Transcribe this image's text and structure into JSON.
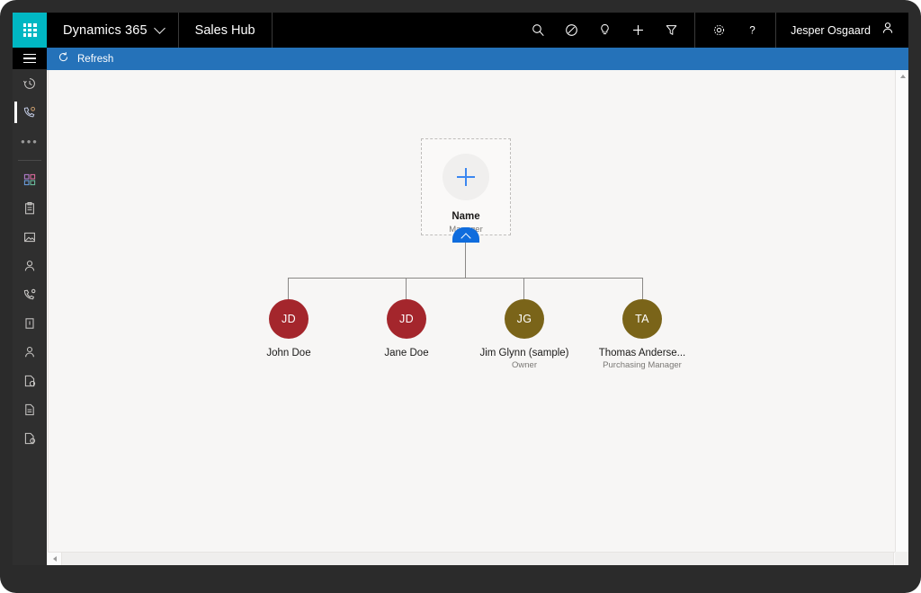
{
  "topbar": {
    "waffle_icon": "waffle-grid-icon",
    "brand": "Dynamics 365",
    "brand_chevron_icon": "chevron-down-icon",
    "app_area": "Sales Hub",
    "actions": [
      {
        "name": "search-icon",
        "label": "Search"
      },
      {
        "name": "assistant-icon",
        "label": "Assistant"
      },
      {
        "name": "lightbulb-icon",
        "label": "Insights"
      },
      {
        "name": "plus-icon",
        "label": "Quick create"
      },
      {
        "name": "filter-icon",
        "label": "Filter"
      }
    ],
    "settings_actions": [
      {
        "name": "gear-icon",
        "label": "Settings"
      },
      {
        "name": "help-icon",
        "label": "Help"
      }
    ],
    "user_name": "Jesper Osgaard",
    "user_avatar_icon": "person-icon"
  },
  "leftrail": {
    "hamburger_icon": "hamburger-icon",
    "items": [
      {
        "name": "sidebar-item-recent",
        "icon": "clock-history-icon",
        "active": false
      },
      {
        "name": "sidebar-item-pinned",
        "icon": "phone-contact-icon",
        "active": true
      },
      {
        "name": "sidebar-item-more",
        "icon": "ellipsis-icon",
        "active": false
      }
    ],
    "entities": [
      {
        "name": "sidebar-item-dashboards",
        "icon": "dashboard-icon"
      },
      {
        "name": "sidebar-item-activities",
        "icon": "clipboard-icon"
      },
      {
        "name": "sidebar-item-accounts",
        "icon": "briefcase-icon"
      },
      {
        "name": "sidebar-item-contacts",
        "icon": "person-icon"
      },
      {
        "name": "sidebar-item-leads",
        "icon": "phone-lead-icon"
      },
      {
        "name": "sidebar-item-opportunities",
        "icon": "opportunity-icon"
      },
      {
        "name": "sidebar-item-competitors",
        "icon": "person-outline-icon"
      },
      {
        "name": "sidebar-item-quotes",
        "icon": "document-check-icon"
      },
      {
        "name": "sidebar-item-orders",
        "icon": "document-icon"
      },
      {
        "name": "sidebar-item-invoices",
        "icon": "document-person-icon"
      }
    ]
  },
  "commandbar": {
    "refresh_icon": "refresh-icon",
    "refresh_label": "Refresh"
  },
  "orgchart": {
    "root": {
      "avatar_icon": "plus-icon",
      "name": "Name",
      "title": "Manager",
      "collapse_icon": "chevron-up-icon"
    },
    "children": [
      {
        "initials": "JD",
        "name": "John Doe",
        "title": "",
        "color": "#a4262c"
      },
      {
        "initials": "JD",
        "name": "Jane Doe",
        "title": "",
        "color": "#a4262c"
      },
      {
        "initials": "JG",
        "name": "Jim Glynn (sample)",
        "title": "Owner",
        "color": "#7a6419"
      },
      {
        "initials": "TA",
        "name": "Thomas Anderse...",
        "title": "Purchasing Manager",
        "color": "#7a6419"
      }
    ]
  },
  "scrollbars": {
    "vertical_up_icon": "triangle-up-icon",
    "vertical_down_icon": "triangle-down-icon",
    "horizontal_left_icon": "triangle-left-icon",
    "horizontal_right_icon": "triangle-right-icon"
  },
  "colors": {
    "accent_teal": "#00b7c3",
    "command_blue": "#2572b9",
    "link_blue": "#3b87f0",
    "collapse_blue": "#0f6cdd",
    "avatar_red": "#a4262c",
    "avatar_olive": "#7a6419",
    "canvas": "#f7f6f5"
  }
}
